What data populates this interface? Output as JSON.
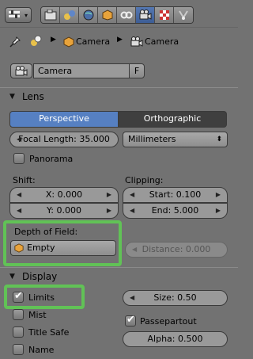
{
  "breadcrumb": {
    "item1": "Camera",
    "item2": "Camera"
  },
  "datablock": {
    "name": "Camera",
    "fake_user": "F"
  },
  "lens_panel": {
    "title": "Lens",
    "projection_tabs": [
      "Perspective",
      "Orthographic"
    ],
    "focal_length": "Focal Length: 35.000",
    "lens_unit": "Millimeters",
    "panorama_label": "Panorama",
    "shift_label": "Shift:",
    "shift_x": "X: 0.000",
    "shift_y": "Y: 0.000",
    "clipping_label": "Clipping:",
    "clip_start": "Start: 0.100",
    "clip_end": "End: 5.000",
    "dof_label": "Depth of Field:",
    "dof_object": "Empty",
    "dof_distance": "Distance: 0.000"
  },
  "display_panel": {
    "title": "Display",
    "limits_label": "Limits",
    "limits_checked": true,
    "mist_label": "Mist",
    "title_safe_label": "Title Safe",
    "name_label": "Name",
    "size": "Size: 0.50",
    "passepartout_label": "Passepartout",
    "passepartout_checked": true,
    "alpha": "Alpha: 0.500"
  },
  "colors": {
    "active_blue": "#5680c2",
    "highlight_green": "#61c256",
    "panel_bg": "#727272"
  }
}
